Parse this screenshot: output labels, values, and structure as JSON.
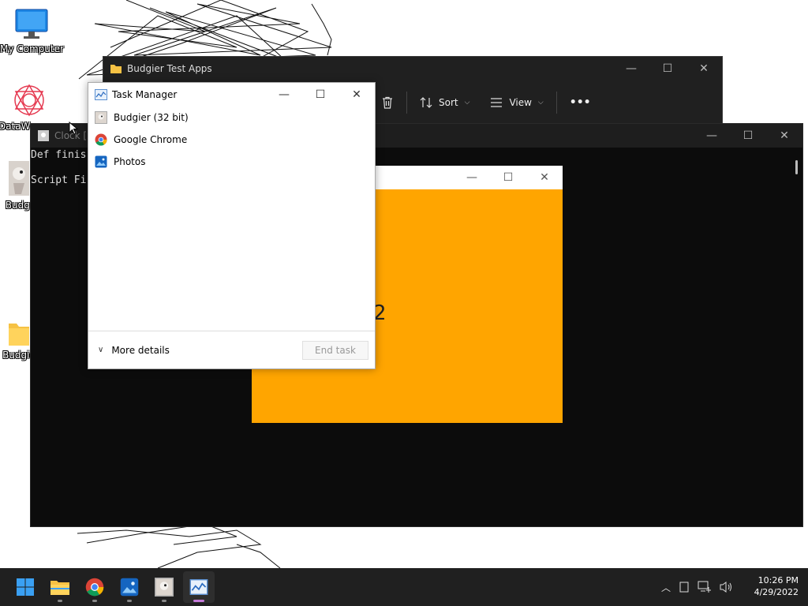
{
  "desktop": {
    "icons": [
      {
        "label": "My Computer"
      },
      {
        "label": "DataW"
      },
      {
        "label": "Budgi"
      },
      {
        "label": "Budgie"
      }
    ]
  },
  "explorer": {
    "title": "Budgier Test Apps",
    "toolbar": {
      "sort_label": "Sort",
      "view_label": "View",
      "more_label": "•••"
    }
  },
  "console": {
    "title": "Clock [S",
    "lines": [
      "Def finis",
      "Script Fi"
    ]
  },
  "clock_window": {
    "display_text": "2",
    "accent": "#ffa500"
  },
  "task_manager": {
    "title": "Task Manager",
    "apps": [
      {
        "label": "Budgier (32 bit)",
        "icon": "budgie-icon"
      },
      {
        "label": "Google Chrome",
        "icon": "chrome-icon"
      },
      {
        "label": "Photos",
        "icon": "photos-icon"
      }
    ],
    "more_details_label": "More details",
    "end_task_label": "End task"
  },
  "taskbar": {
    "apps": [
      "start-icon",
      "file-explorer-icon",
      "chrome-icon",
      "photos-icon",
      "budgie-icon",
      "task-manager-icon"
    ],
    "time": "10:26 PM",
    "date": "4/29/2022"
  }
}
